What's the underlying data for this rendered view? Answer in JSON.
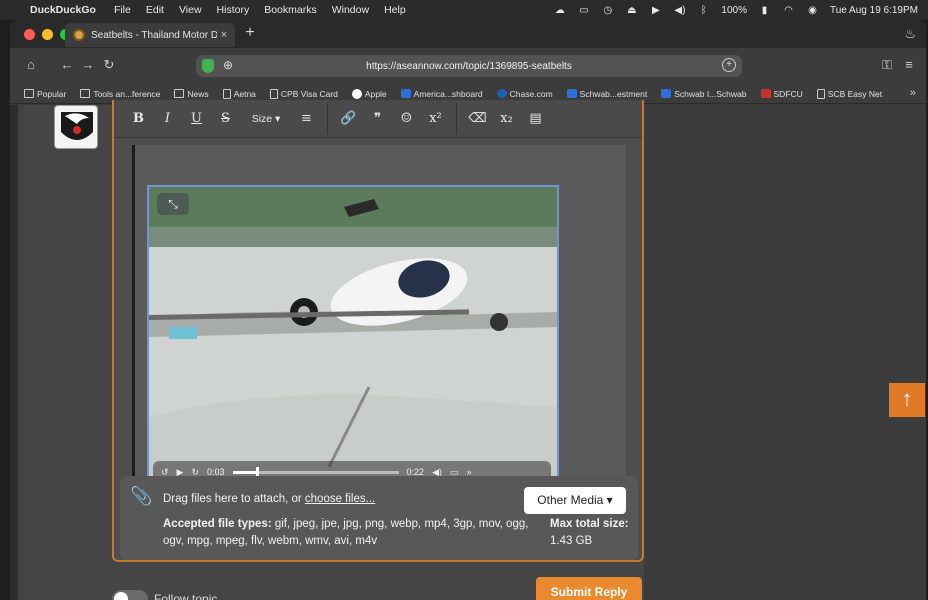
{
  "menubar": {
    "app_name": "DuckDuckGo",
    "items": [
      "File",
      "Edit",
      "View",
      "History",
      "Bookmarks",
      "Window",
      "Help"
    ],
    "battery": "100%",
    "clock": "Tue Aug 19  6:19PM"
  },
  "tab": {
    "title": "Seatbelts - Thailand Motor D",
    "close": "×",
    "new_tab": "+"
  },
  "toolbar": {
    "url": "https://aseannow.com/topic/1369895-seatbelts"
  },
  "bookmarks": [
    {
      "label": "Popular",
      "icon": "folder-icon"
    },
    {
      "label": "Tools an...ference",
      "icon": "folder-icon"
    },
    {
      "label": "News",
      "icon": "folder-icon"
    },
    {
      "label": "Aetna",
      "icon": "page-icon"
    },
    {
      "label": "CPB Visa Card",
      "icon": "page-icon"
    },
    {
      "label": "Apple",
      "icon": "apple-icon"
    },
    {
      "label": "America...shboard",
      "icon": "bank-icon"
    },
    {
      "label": "Chase.com",
      "icon": "chase-icon"
    },
    {
      "label": "Schwab...estment",
      "icon": "schwab-icon"
    },
    {
      "label": "Schwab I...Schwab",
      "icon": "schwab-icon"
    },
    {
      "label": "SDFCU",
      "icon": "sdfcu-icon"
    },
    {
      "label": "SCB Easy Net",
      "icon": "page-icon"
    }
  ],
  "editor": {
    "format_buttons": [
      "B",
      "I",
      "U",
      "S"
    ],
    "size_label": "Size ▾",
    "format_buttons2": [
      "≡"
    ],
    "insert_buttons": [
      "🔗",
      "❞",
      "☺",
      "x²"
    ],
    "extra_buttons": [
      "⌫",
      "x₂",
      "▤"
    ],
    "video": {
      "current_time": "0:03",
      "duration": "0:22",
      "progress": 0.14
    }
  },
  "attach": {
    "drag_text": "Drag files here to attach, or ",
    "choose_text": "choose files...",
    "accepted_label": "Accepted file types:",
    "accepted_types": " gif, jpeg, jpe, jpg, png, webp, mp4, 3gp, mov, ogg, ogv, mpg, mpeg, flv, webm, wmv, avi, m4v",
    "other_media": "Other Media ▾",
    "max_label": "Max total size:",
    "max_value": " 1.43 GB"
  },
  "footer": {
    "follow_label": "Follow topic",
    "submit_label": "Submit Reply"
  },
  "colors": {
    "accent": "#e98a2f",
    "editor_border": "#c87a2a"
  }
}
